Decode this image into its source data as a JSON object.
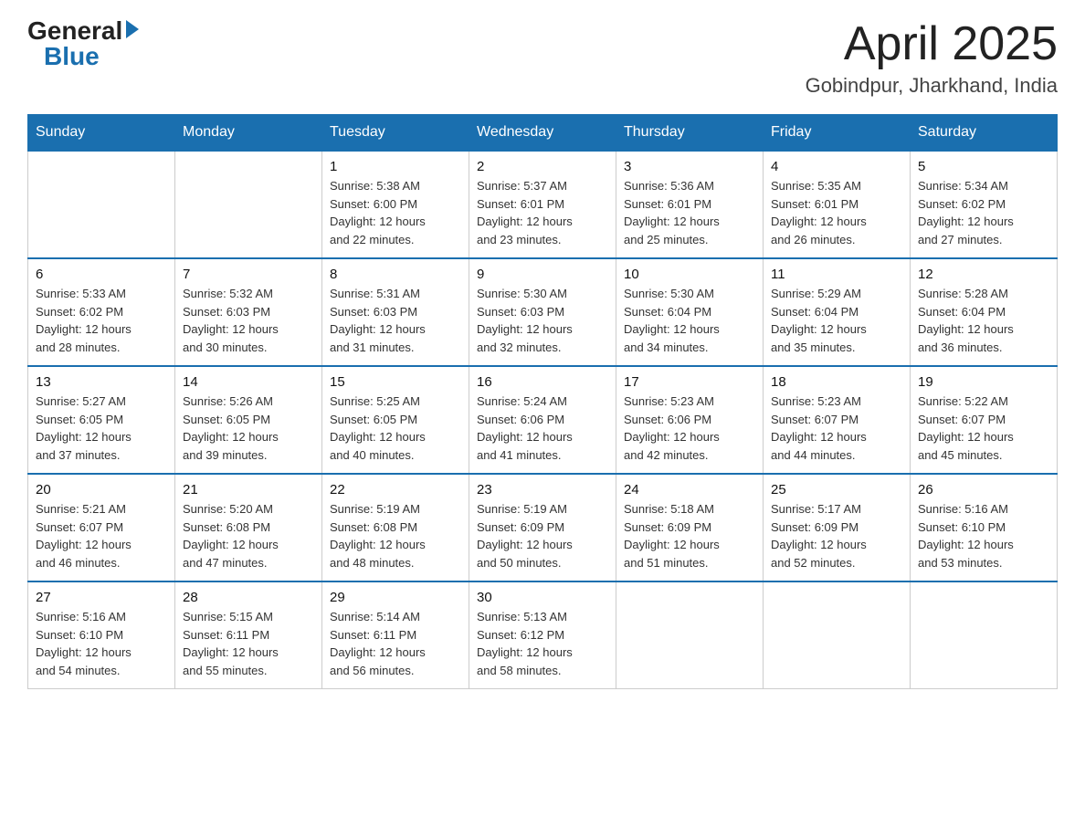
{
  "header": {
    "logo_general": "General",
    "logo_blue": "Blue",
    "month_title": "April 2025",
    "location": "Gobindpur, Jharkhand, India"
  },
  "weekdays": [
    "Sunday",
    "Monday",
    "Tuesday",
    "Wednesday",
    "Thursday",
    "Friday",
    "Saturday"
  ],
  "weeks": [
    [
      {
        "day": "",
        "info": ""
      },
      {
        "day": "",
        "info": ""
      },
      {
        "day": "1",
        "info": "Sunrise: 5:38 AM\nSunset: 6:00 PM\nDaylight: 12 hours\nand 22 minutes."
      },
      {
        "day": "2",
        "info": "Sunrise: 5:37 AM\nSunset: 6:01 PM\nDaylight: 12 hours\nand 23 minutes."
      },
      {
        "day": "3",
        "info": "Sunrise: 5:36 AM\nSunset: 6:01 PM\nDaylight: 12 hours\nand 25 minutes."
      },
      {
        "day": "4",
        "info": "Sunrise: 5:35 AM\nSunset: 6:01 PM\nDaylight: 12 hours\nand 26 minutes."
      },
      {
        "day": "5",
        "info": "Sunrise: 5:34 AM\nSunset: 6:02 PM\nDaylight: 12 hours\nand 27 minutes."
      }
    ],
    [
      {
        "day": "6",
        "info": "Sunrise: 5:33 AM\nSunset: 6:02 PM\nDaylight: 12 hours\nand 28 minutes."
      },
      {
        "day": "7",
        "info": "Sunrise: 5:32 AM\nSunset: 6:03 PM\nDaylight: 12 hours\nand 30 minutes."
      },
      {
        "day": "8",
        "info": "Sunrise: 5:31 AM\nSunset: 6:03 PM\nDaylight: 12 hours\nand 31 minutes."
      },
      {
        "day": "9",
        "info": "Sunrise: 5:30 AM\nSunset: 6:03 PM\nDaylight: 12 hours\nand 32 minutes."
      },
      {
        "day": "10",
        "info": "Sunrise: 5:30 AM\nSunset: 6:04 PM\nDaylight: 12 hours\nand 34 minutes."
      },
      {
        "day": "11",
        "info": "Sunrise: 5:29 AM\nSunset: 6:04 PM\nDaylight: 12 hours\nand 35 minutes."
      },
      {
        "day": "12",
        "info": "Sunrise: 5:28 AM\nSunset: 6:04 PM\nDaylight: 12 hours\nand 36 minutes."
      }
    ],
    [
      {
        "day": "13",
        "info": "Sunrise: 5:27 AM\nSunset: 6:05 PM\nDaylight: 12 hours\nand 37 minutes."
      },
      {
        "day": "14",
        "info": "Sunrise: 5:26 AM\nSunset: 6:05 PM\nDaylight: 12 hours\nand 39 minutes."
      },
      {
        "day": "15",
        "info": "Sunrise: 5:25 AM\nSunset: 6:05 PM\nDaylight: 12 hours\nand 40 minutes."
      },
      {
        "day": "16",
        "info": "Sunrise: 5:24 AM\nSunset: 6:06 PM\nDaylight: 12 hours\nand 41 minutes."
      },
      {
        "day": "17",
        "info": "Sunrise: 5:23 AM\nSunset: 6:06 PM\nDaylight: 12 hours\nand 42 minutes."
      },
      {
        "day": "18",
        "info": "Sunrise: 5:23 AM\nSunset: 6:07 PM\nDaylight: 12 hours\nand 44 minutes."
      },
      {
        "day": "19",
        "info": "Sunrise: 5:22 AM\nSunset: 6:07 PM\nDaylight: 12 hours\nand 45 minutes."
      }
    ],
    [
      {
        "day": "20",
        "info": "Sunrise: 5:21 AM\nSunset: 6:07 PM\nDaylight: 12 hours\nand 46 minutes."
      },
      {
        "day": "21",
        "info": "Sunrise: 5:20 AM\nSunset: 6:08 PM\nDaylight: 12 hours\nand 47 minutes."
      },
      {
        "day": "22",
        "info": "Sunrise: 5:19 AM\nSunset: 6:08 PM\nDaylight: 12 hours\nand 48 minutes."
      },
      {
        "day": "23",
        "info": "Sunrise: 5:19 AM\nSunset: 6:09 PM\nDaylight: 12 hours\nand 50 minutes."
      },
      {
        "day": "24",
        "info": "Sunrise: 5:18 AM\nSunset: 6:09 PM\nDaylight: 12 hours\nand 51 minutes."
      },
      {
        "day": "25",
        "info": "Sunrise: 5:17 AM\nSunset: 6:09 PM\nDaylight: 12 hours\nand 52 minutes."
      },
      {
        "day": "26",
        "info": "Sunrise: 5:16 AM\nSunset: 6:10 PM\nDaylight: 12 hours\nand 53 minutes."
      }
    ],
    [
      {
        "day": "27",
        "info": "Sunrise: 5:16 AM\nSunset: 6:10 PM\nDaylight: 12 hours\nand 54 minutes."
      },
      {
        "day": "28",
        "info": "Sunrise: 5:15 AM\nSunset: 6:11 PM\nDaylight: 12 hours\nand 55 minutes."
      },
      {
        "day": "29",
        "info": "Sunrise: 5:14 AM\nSunset: 6:11 PM\nDaylight: 12 hours\nand 56 minutes."
      },
      {
        "day": "30",
        "info": "Sunrise: 5:13 AM\nSunset: 6:12 PM\nDaylight: 12 hours\nand 58 minutes."
      },
      {
        "day": "",
        "info": ""
      },
      {
        "day": "",
        "info": ""
      },
      {
        "day": "",
        "info": ""
      }
    ]
  ]
}
